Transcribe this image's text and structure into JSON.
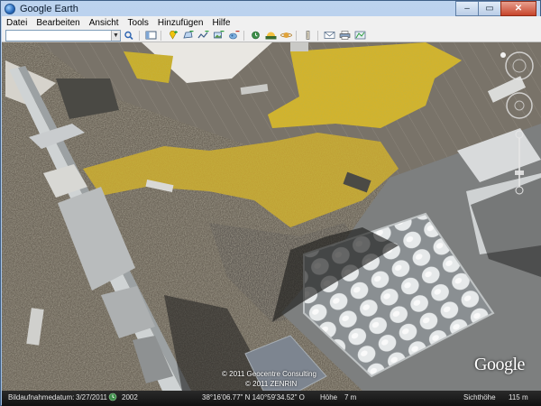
{
  "window": {
    "title": "Google Earth",
    "buttons": {
      "minimize": "–",
      "maximize": "▭",
      "close": "✕"
    }
  },
  "menu": [
    "Datei",
    "Bearbeiten",
    "Ansicht",
    "Tools",
    "Hinzufügen",
    "Hilfe"
  ],
  "search": {
    "value": "",
    "placeholder": ""
  },
  "toolbar_icons": [
    "search-icon",
    "sidebar-icon",
    "placemark-icon",
    "polygon-icon",
    "path-icon",
    "overlay-icon",
    "tour-icon",
    "historical-imagery-icon",
    "sunlight-icon",
    "planets-icon",
    "ruler-icon",
    "email-icon",
    "print-icon",
    "maps-icon"
  ],
  "map": {
    "copyright": [
      "© 2011 Geocentre Consulting",
      "© 2011 ZENRIN"
    ],
    "logo": "Google"
  },
  "status": {
    "imagery_date_label": "Bildaufnahmedatum:",
    "imagery_date": "3/27/2011",
    "year": "2002",
    "coords": "38°16'06.77\" N  140°59'34.52\" O",
    "elevation_label": "Höhe",
    "elevation": "7 m",
    "eye_alt_label": "Sichthöhe",
    "eye_alt": "115 m"
  },
  "colors": {
    "titlebar": "#bcd3ee",
    "close": "#c7442b",
    "statusbar": "#1a1a1a"
  }
}
